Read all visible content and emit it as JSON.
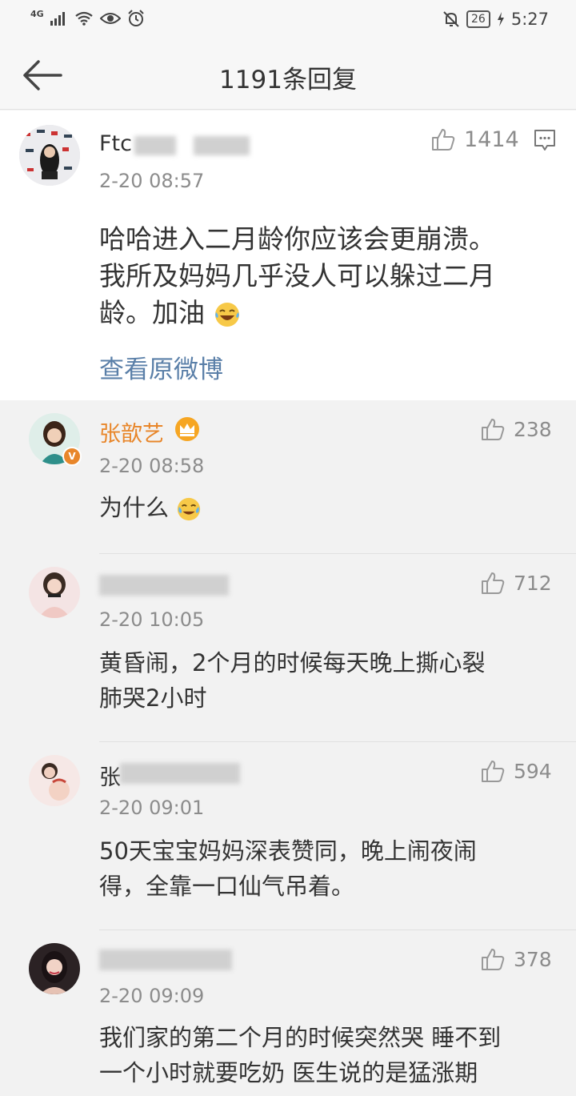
{
  "status_bar": {
    "network": "4G",
    "battery": "26",
    "time": "5:27"
  },
  "header": {
    "title": "1191条回复",
    "back_icon": "back-arrow-icon"
  },
  "main_comment": {
    "username_visible": "Ftc",
    "timestamp": "2-20 08:57",
    "likes": "1414",
    "text_line1": "哈哈进入二月龄你应该会更崩溃。",
    "text_line2": "我所及妈妈几乎没人可以躲过二月",
    "text_line3": "龄。加油",
    "view_original": "查看原微博",
    "reply_icon": "comment-bubble-icon"
  },
  "replies": [
    {
      "username": "张歆艺",
      "timestamp": "2-20 08:58",
      "likes": "238",
      "text": "为什么",
      "name_color": "#e8862a"
    },
    {
      "username_visible": "",
      "timestamp": "2-20 10:05",
      "likes": "712",
      "text_line1": "黄昏闹，2个月的时候每天晚上撕心裂",
      "text_line2": "肺哭2小时"
    },
    {
      "username_visible": "张",
      "timestamp": "2-20 09:01",
      "likes": "594",
      "text_line1": "50天宝宝妈妈深表赞同，晚上闹夜闹",
      "text_line2": "得，全靠一口仙气吊着。"
    },
    {
      "username_visible": "",
      "timestamp": "2-20 09:09",
      "likes": "378",
      "text_line1": "我们家的第二个月的时候突然哭 睡不到",
      "text_line2": "一个小时就要吃奶 医生说的是猛涨期"
    }
  ]
}
